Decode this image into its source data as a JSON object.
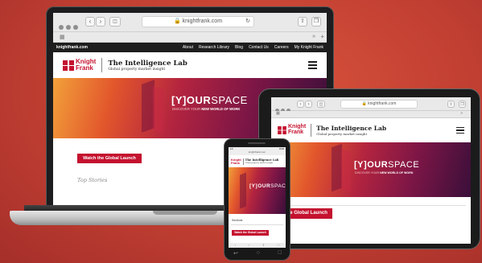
{
  "url": "knightfrank.com",
  "tab_label": "knightfrank.com",
  "nav": {
    "site": "knightfrank.com",
    "links": [
      "About",
      "Research Library",
      "Blog",
      "Contact Us",
      "Careers",
      "My Knight Frank"
    ]
  },
  "brand": {
    "logo_line1": "Knight",
    "logo_line2": "Frank",
    "title": "The Intelligence Lab",
    "subtitle": "Global property market insight"
  },
  "hero": {
    "headline_bracket_open": "[",
    "headline_y": "Y",
    "headline_bracket_close": "]",
    "headline_our": "OUR",
    "headline_space": "SPACE",
    "tagline_pre": "DISCOVER YOUR ",
    "tagline_bold": "NEW WORLD OF WORK"
  },
  "cta_label": "Watch the Global Launch",
  "top_stories_label": "Top Stories",
  "phone": {
    "status_left": "LA",
    "status_right": "8:00",
    "sections_label": "Sections"
  },
  "colors": {
    "brand_red": "#c4122f",
    "background": "#c13f32"
  }
}
